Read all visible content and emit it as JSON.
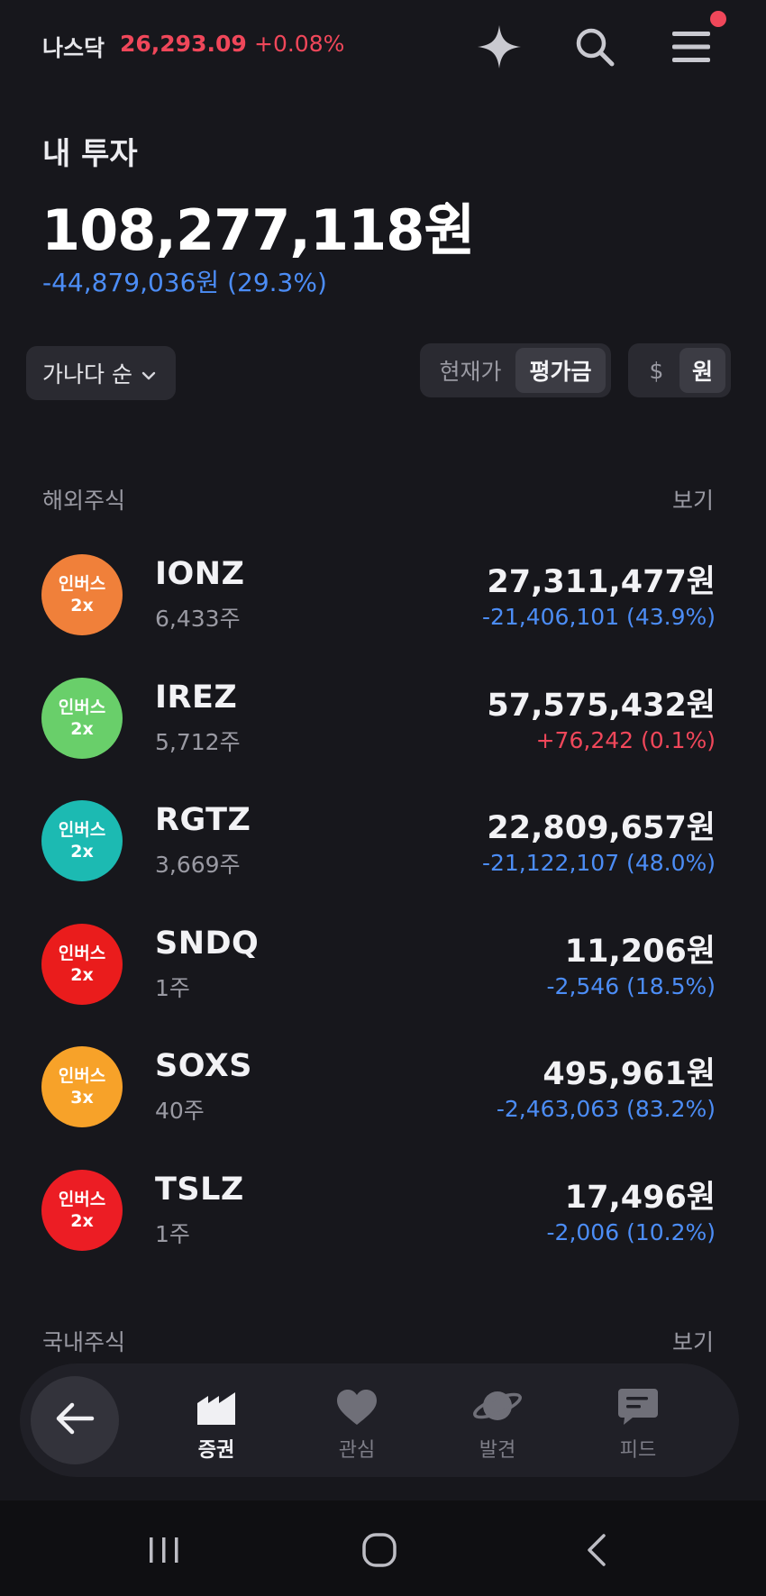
{
  "index": {
    "name": "나스닥",
    "value": "26,293.09",
    "change": "+0.08%"
  },
  "hero": {
    "label": "내 투자",
    "total": "108,277,118원",
    "change": "-44,879,036원 (29.3%)"
  },
  "controls": {
    "sort_label": "가나다 순",
    "price_toggle": [
      "현재가",
      "평가금"
    ],
    "price_active": "평가금",
    "currency_toggle": [
      "$",
      "원"
    ],
    "currency_active": "원"
  },
  "overseas": {
    "title": "해외주식",
    "view_label": "보기",
    "stocks": [
      {
        "name": "IONZ",
        "qty": "6,433주",
        "value": "27,311,477원",
        "change": "-21,406,101 (43.9%)",
        "direction": "neg",
        "logo_line1": "인버스",
        "logo_line2": "2x",
        "logo_color": "#f0803a"
      },
      {
        "name": "IREZ",
        "qty": "5,712주",
        "value": "57,575,432원",
        "change": "+76,242 (0.1%)",
        "direction": "pos",
        "logo_line1": "인버스",
        "logo_line2": "2x",
        "logo_color": "#69cf6a"
      },
      {
        "name": "RGTZ",
        "qty": "3,669주",
        "value": "22,809,657원",
        "change": "-21,122,107 (48.0%)",
        "direction": "neg",
        "logo_line1": "인버스",
        "logo_line2": "2x",
        "logo_color": "#1cbab2"
      },
      {
        "name": "SNDQ",
        "qty": "1주",
        "value": "11,206원",
        "change": "-2,546 (18.5%)",
        "direction": "neg",
        "logo_line1": "인버스",
        "logo_line2": "2x",
        "logo_color": "#ea1c1c"
      },
      {
        "name": "SOXS",
        "qty": "40주",
        "value": "495,961원",
        "change": "-2,463,063 (83.2%)",
        "direction": "neg",
        "logo_line1": "인버스",
        "logo_line2": "3x",
        "logo_color": "#f7a229"
      },
      {
        "name": "TSLZ",
        "qty": "1주",
        "value": "17,496원",
        "change": "-2,006 (10.2%)",
        "direction": "neg",
        "logo_line1": "인버스",
        "logo_line2": "2x",
        "logo_color": "#ec1d24"
      }
    ]
  },
  "domestic": {
    "title": "국내주식",
    "view_label": "보기"
  },
  "nav": {
    "items": [
      {
        "label": "증권",
        "icon": "chart-factory-icon",
        "active": true
      },
      {
        "label": "관심",
        "icon": "heart-icon",
        "active": false
      },
      {
        "label": "발견",
        "icon": "planet-icon",
        "active": false
      },
      {
        "label": "피드",
        "icon": "chat-bubble-icon",
        "active": false
      }
    ]
  },
  "colors": {
    "negative": "#4c8df6",
    "positive": "#f0475a",
    "background": "#17171c"
  }
}
